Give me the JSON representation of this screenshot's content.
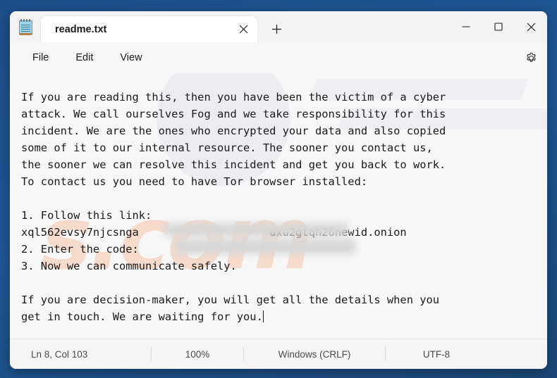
{
  "window": {
    "app_icon": "notepad-icon",
    "caption": {
      "minimize": "minimize-icon",
      "maximize": "maximize-icon",
      "close": "close-icon"
    }
  },
  "tabs": [
    {
      "title": "readme.txt",
      "close_icon": "close-icon",
      "active": true
    }
  ],
  "new_tab": {
    "icon": "plus-icon",
    "label": "+"
  },
  "menubar": {
    "items": [
      {
        "label": "File"
      },
      {
        "label": "Edit"
      },
      {
        "label": "View"
      }
    ],
    "settings": {
      "icon": "gear-icon",
      "label": "Settings"
    }
  },
  "document": {
    "filename": "readme.txt",
    "lines": [
      "If you are reading this, then you have been the victim of a cyber",
      "attack. We call ourselves Fog and we take responsibility for this",
      "incident. We are the ones who encrypted your data and also copied",
      "some of it to our internal resource. The sooner you contact us,",
      "the sooner we can resolve this incident and get you back to work.",
      "To contact us you need to have Tor browser installed:",
      "",
      "1. Follow this link:",
      "xql562evsy7njcsnga                    uxu2gtqh26newid.onion",
      "2. Enter the code:",
      "3. Now we can communicate safely.",
      "",
      "If you are decision-maker, you will get all the details when you",
      "get in touch. We are waiting for you."
    ],
    "redactions": [
      {
        "name": "redacted-onion-middle",
        "line": 9
      },
      {
        "name": "redacted-code-value",
        "line": 10
      }
    ],
    "caret_visible": true
  },
  "statusbar": {
    "position": "Ln 8, Col 103",
    "zoom": "100%",
    "line_ending": "Windows (CRLF)",
    "encoding": "UTF-8"
  },
  "watermark": {
    "text": "s.com"
  },
  "colors": {
    "desktop_blue": "#1d4e89",
    "window_bg": "#f7f7f7",
    "tab_active": "#ffffff",
    "text": "#1a1a1a",
    "status_text": "#4a4a4a",
    "watermark_orange": "#f6a77a"
  }
}
